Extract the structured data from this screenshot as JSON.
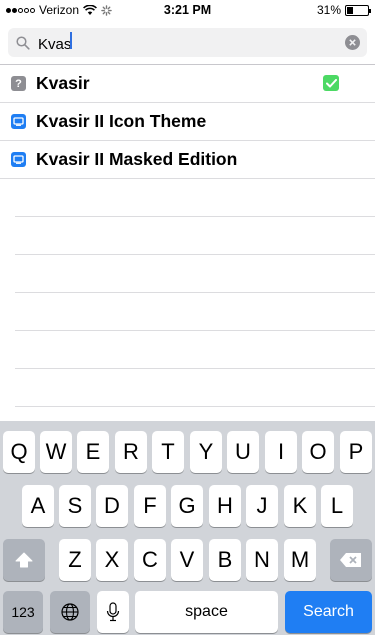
{
  "status_bar": {
    "carrier": "Verizon",
    "time": "3:21 PM",
    "battery": "31%",
    "battery_level": 0.31,
    "signal_bars_on": 2,
    "signal_bars_total": 5
  },
  "search": {
    "query": "Kvas",
    "icon": "search-icon",
    "clear_icon": "clear-icon"
  },
  "results": [
    {
      "title": "Kvasir",
      "icon": "question-icon",
      "icon_color": "#8e8e93",
      "checked": true
    },
    {
      "title": "Kvasir II Icon Theme",
      "icon": "package-icon",
      "icon_color": "#1f7ef3",
      "checked": false
    },
    {
      "title": "Kvasir II Masked Edition",
      "icon": "package-icon",
      "icon_color": "#1f7ef3",
      "checked": false
    }
  ],
  "keyboard": {
    "row1": [
      "Q",
      "W",
      "E",
      "R",
      "T",
      "Y",
      "U",
      "I",
      "O",
      "P"
    ],
    "row2": [
      "A",
      "S",
      "D",
      "F",
      "G",
      "H",
      "J",
      "K",
      "L"
    ],
    "row3": [
      "Z",
      "X",
      "C",
      "V",
      "B",
      "N",
      "M"
    ],
    "numbers_key": "123",
    "space_key": "space",
    "search_key": "Search",
    "colors": {
      "background": "#d1d4d9",
      "key": "#ffffff",
      "dark_key": "#aeb3bb",
      "action_key": "#1f7ef3"
    }
  },
  "colors": {
    "accent": "#1f7ef3",
    "check": "#4cd964",
    "separator": "#dcdcdf"
  }
}
